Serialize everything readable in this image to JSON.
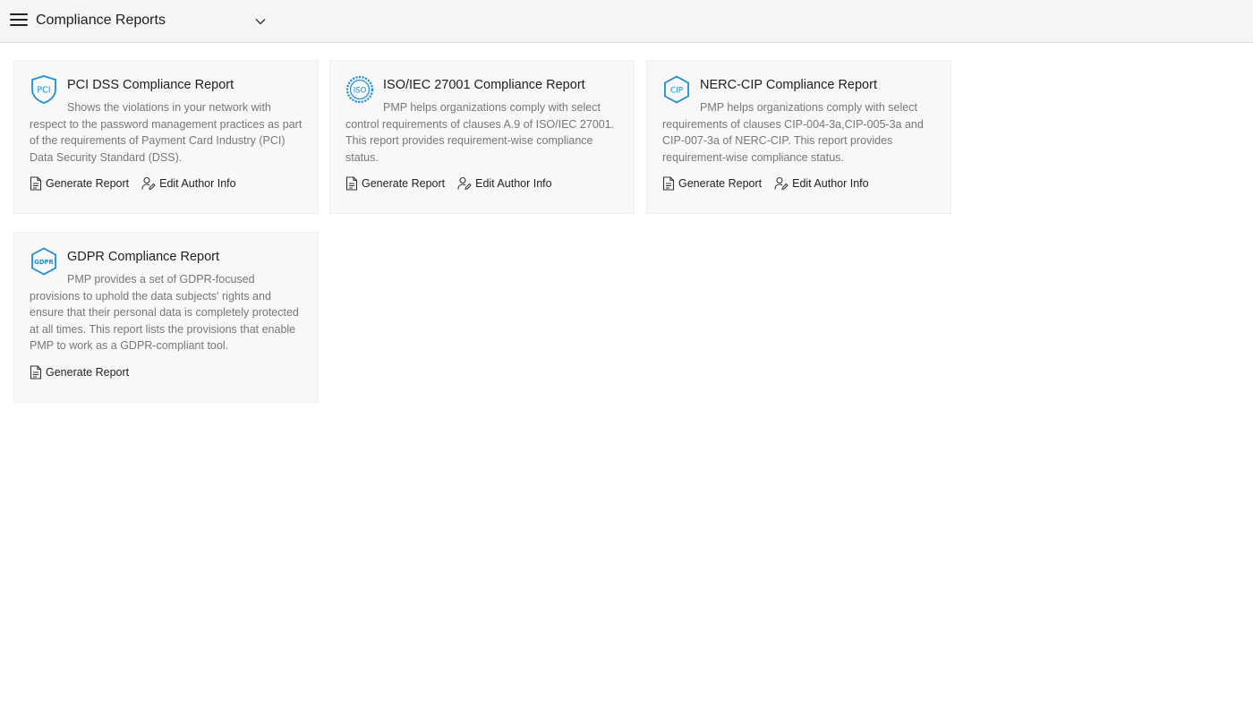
{
  "header": {
    "title": "Compliance Reports"
  },
  "reports": [
    {
      "badge": "PCI",
      "title": "PCI DSS Compliance Report",
      "description": "Shows the violations in your network with respect to the password management practices as part of the requirements of Payment Card Industry (PCI) Data Security Standard (DSS).",
      "generate_label": "Generate Report",
      "edit_label": "Edit Author Info"
    },
    {
      "badge": "ISO",
      "title": "ISO/IEC 27001 Compliance Report",
      "description": "PMP helps organizations comply with select control requirements of clauses A.9 of ISO/IEC 27001. This report provides requirement-wise compliance status.",
      "generate_label": "Generate Report",
      "edit_label": "Edit Author Info"
    },
    {
      "badge": "CIP",
      "title": "NERC-CIP Compliance Report",
      "description": "PMP helps organizations comply with select requirements of clauses CIP-004-3a,CIP-005-3a and CIP-007-3a of NERC-CIP. This report provides requirement-wise compliance status.",
      "generate_label": "Generate Report",
      "edit_label": "Edit Author Info"
    },
    {
      "badge": "GDPR",
      "title": "GDPR Compliance Report",
      "description": "PMP provides a set of GDPR-focused provisions to uphold the data subjects' rights and ensure that their personal data is completely protected at all times. This report lists the provisions that enable PMP to work as a GDPR-compliant tool.",
      "generate_label": "Generate Report"
    }
  ],
  "colors": {
    "accent": "#1a8fd8",
    "card_bg": "#f8f8f8",
    "header_bg": "#f5f5f5"
  }
}
